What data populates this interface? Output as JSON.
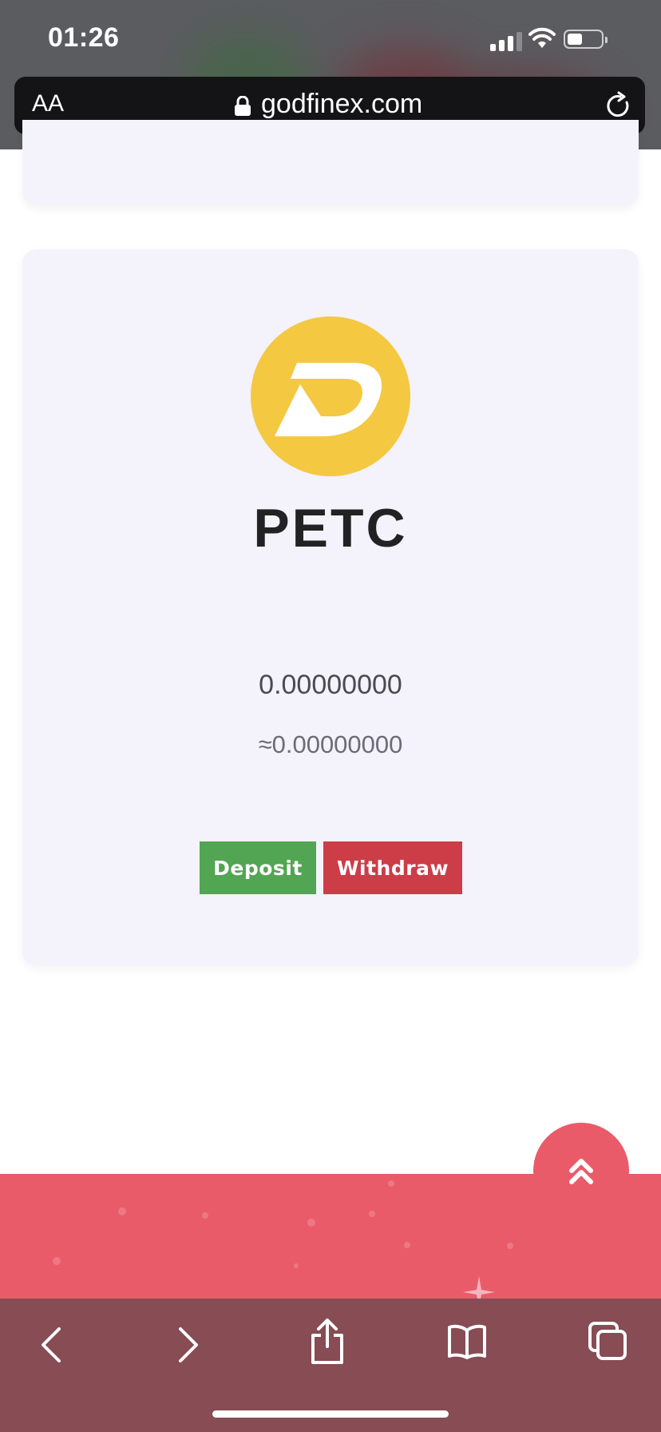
{
  "status_bar": {
    "time": "01:26"
  },
  "address_bar": {
    "text_size_label": "AA",
    "url": "godfinex.com"
  },
  "coin_card": {
    "symbol": "PETC",
    "balance": "0.00000000",
    "approx_value": "≈0.00000000",
    "deposit_label": "Deposit",
    "withdraw_label": "Withdraw"
  },
  "colors": {
    "deposit": "#52a552",
    "withdraw": "#cc3d48",
    "footer": "#ea5b6a",
    "coin_logo": "#f5c842"
  },
  "icons": [
    "signal-icon",
    "wifi-icon",
    "battery-icon",
    "lock-icon",
    "reload-icon",
    "chevrons-up-icon",
    "back-icon",
    "forward-icon",
    "share-icon",
    "bookmarks-icon",
    "tabs-icon"
  ]
}
